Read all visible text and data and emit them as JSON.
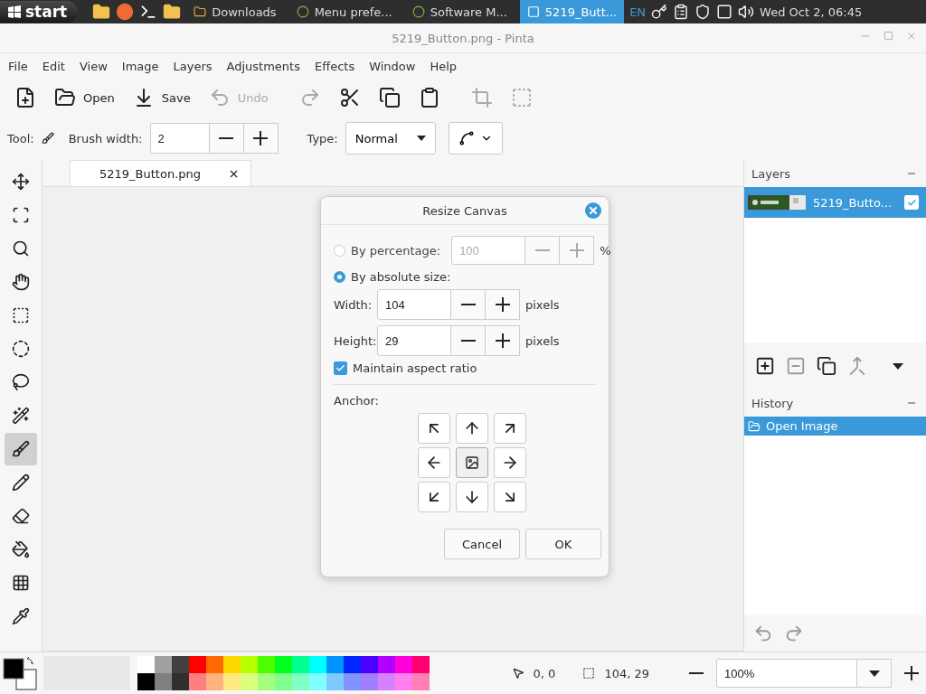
{
  "taskbar": {
    "start": "start",
    "tasks": [
      {
        "label": "Downloads",
        "selected": false
      },
      {
        "label": "Menu prefe...",
        "selected": false
      },
      {
        "label": "Software M...",
        "selected": false
      },
      {
        "label": "5219_Butt...",
        "selected": true
      }
    ],
    "language": "EN",
    "clock": "Wed Oct  2, 06:45"
  },
  "window": {
    "title": "5219_Button.png - Pinta"
  },
  "menu": [
    "File",
    "Edit",
    "View",
    "Image",
    "Layers",
    "Adjustments",
    "Effects",
    "Window",
    "Help"
  ],
  "toolbar": [
    {
      "disabled": false
    },
    {
      "label": "Open",
      "disabled": false
    },
    {
      "label": "Save",
      "disabled": false
    },
    {
      "label": "Undo",
      "disabled": true
    },
    {
      "disabled": true
    },
    {
      "disabled": false
    },
    {
      "disabled": false
    },
    {
      "disabled": false
    },
    {
      "disabled": true
    },
    {
      "disabled": true
    }
  ],
  "tool_options": {
    "tool_label": "Tool:",
    "brush_label": "Brush width:",
    "brush_value": "2",
    "type_label": "Type:",
    "type_value": "Normal"
  },
  "tools": [
    {
      "selected": false
    },
    {
      "selected": false
    },
    {
      "selected": false
    },
    {
      "selected": false
    },
    {
      "selected": false
    },
    {
      "selected": false
    },
    {
      "selected": false
    },
    {
      "selected": false
    },
    {
      "selected": true
    },
    {
      "selected": false
    },
    {
      "selected": false
    },
    {
      "selected": false
    },
    {
      "selected": false
    },
    {
      "selected": false
    }
  ],
  "document_tabs": [
    {
      "label": "5219_Button.png",
      "selected": true
    }
  ],
  "layers_panel": {
    "title": "Layers",
    "layers": [
      {
        "name": "5219_Butto...",
        "selected": true,
        "visible": true
      }
    ]
  },
  "history_panel": {
    "title": "History",
    "items": [
      {
        "label": "Open Image",
        "selected": true
      }
    ]
  },
  "dialog": {
    "title": "Resize Canvas",
    "by_percentage": {
      "label": "By percentage:",
      "selected": false,
      "value": "100",
      "unit": "%"
    },
    "by_absolute": {
      "label": "By absolute size:",
      "selected": true
    },
    "width": {
      "label": "Width:",
      "value": "104",
      "unit": "pixels"
    },
    "height": {
      "label": "Height:",
      "value": "29",
      "unit": "pixels"
    },
    "maintain_aspect": {
      "label": "Maintain aspect ratio",
      "checked": true
    },
    "anchor": {
      "label": "Anchor:",
      "cells": [
        {
          "selected": false
        },
        {
          "selected": false
        },
        {
          "selected": false
        },
        {
          "selected": false
        },
        {
          "selected": true
        },
        {
          "selected": false
        },
        {
          "selected": false
        },
        {
          "selected": false
        },
        {
          "selected": false
        }
      ]
    },
    "buttons": [
      "Cancel",
      "OK"
    ]
  },
  "palette": {
    "top": [
      {
        "color": "#ffffff"
      },
      {
        "color": "#a0a0a0"
      },
      {
        "color": "#404040"
      },
      {
        "color": "#ff0000"
      },
      {
        "color": "#ff6a00"
      },
      {
        "color": "#ffd800"
      },
      {
        "color": "#b6ff00"
      },
      {
        "color": "#4cff00"
      },
      {
        "color": "#00ff21"
      },
      {
        "color": "#00ff90"
      },
      {
        "color": "#00ffff"
      },
      {
        "color": "#0094ff"
      },
      {
        "color": "#0026ff"
      },
      {
        "color": "#4800ff"
      },
      {
        "color": "#b200ff"
      },
      {
        "color": "#ff00dc"
      },
      {
        "color": "#ff006e"
      }
    ],
    "bottom": [
      {
        "color": "#000000"
      },
      {
        "color": "#808080"
      },
      {
        "color": "#303030"
      },
      {
        "color": "#ff7f7f"
      },
      {
        "color": "#ffb27f"
      },
      {
        "color": "#ffe97f"
      },
      {
        "color": "#daff7f"
      },
      {
        "color": "#a5ff7f"
      },
      {
        "color": "#7fff8e"
      },
      {
        "color": "#7fffc5"
      },
      {
        "color": "#7fffff"
      },
      {
        "color": "#7fc9ff"
      },
      {
        "color": "#7f92ff"
      },
      {
        "color": "#a17fff"
      },
      {
        "color": "#d67fff"
      },
      {
        "color": "#ff7fed"
      },
      {
        "color": "#ff7fb6"
      }
    ]
  },
  "status": {
    "cursor": "0, 0",
    "selection": "104, 29",
    "zoom": "100%"
  }
}
